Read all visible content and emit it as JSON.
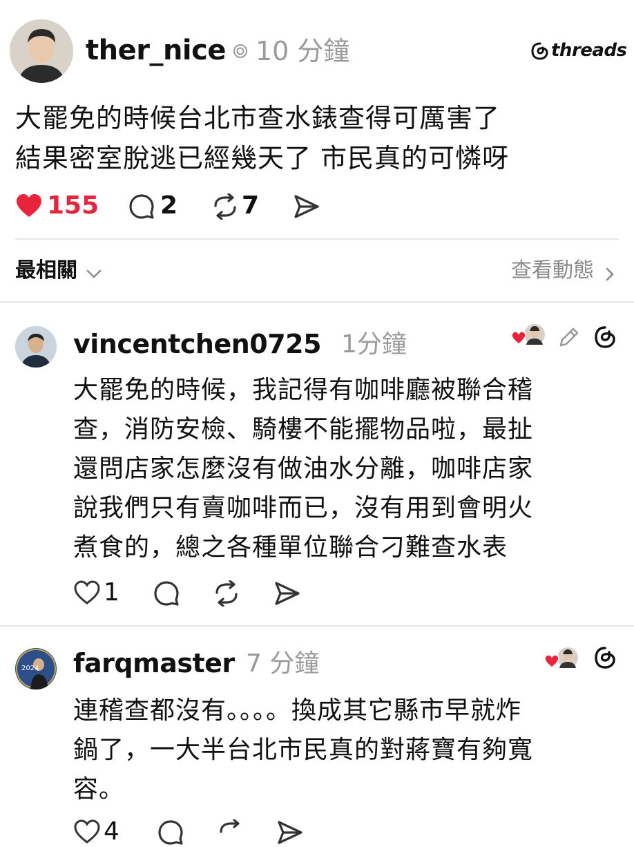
{
  "post": {
    "username": "ther_nice",
    "time": "10 分鐘",
    "brand": "threads",
    "lines": [
      "大罷免的時候台北市查水錶查得可厲害了",
      "結果密室脫逃已經幾天了 市民真的可憐呀"
    ],
    "likes": "155",
    "replies": "2",
    "reposts": "7"
  },
  "sort": {
    "label": "最相關",
    "activity": "查看動態"
  },
  "comments": [
    {
      "username": "vincentchen0725",
      "time": "1分鐘",
      "lines": [
        "大罷免的時候，我記得有咖啡廳被聯合稽",
        "查，消防安檢、騎樓不能擺物品啦，最扯",
        "還問店家怎麼沒有做油水分離，咖啡店家",
        "說我們只有賣咖啡而已，沒有用到會明火",
        "煮食的，總之各種單位聯合刁難查水表"
      ],
      "likes": "1"
    },
    {
      "username": "farqmaster",
      "time": "7 分鐘",
      "lines": [
        "連稽查都沒有。。。。換成其它縣市早就炸",
        "鍋了，一大半台北市民真的對蔣寶有夠寬",
        "容。"
      ],
      "likes": "4"
    }
  ],
  "colors": {
    "heart": "#e8243c",
    "muted": "#9a9a9a",
    "divider": "#e6e6e6"
  }
}
